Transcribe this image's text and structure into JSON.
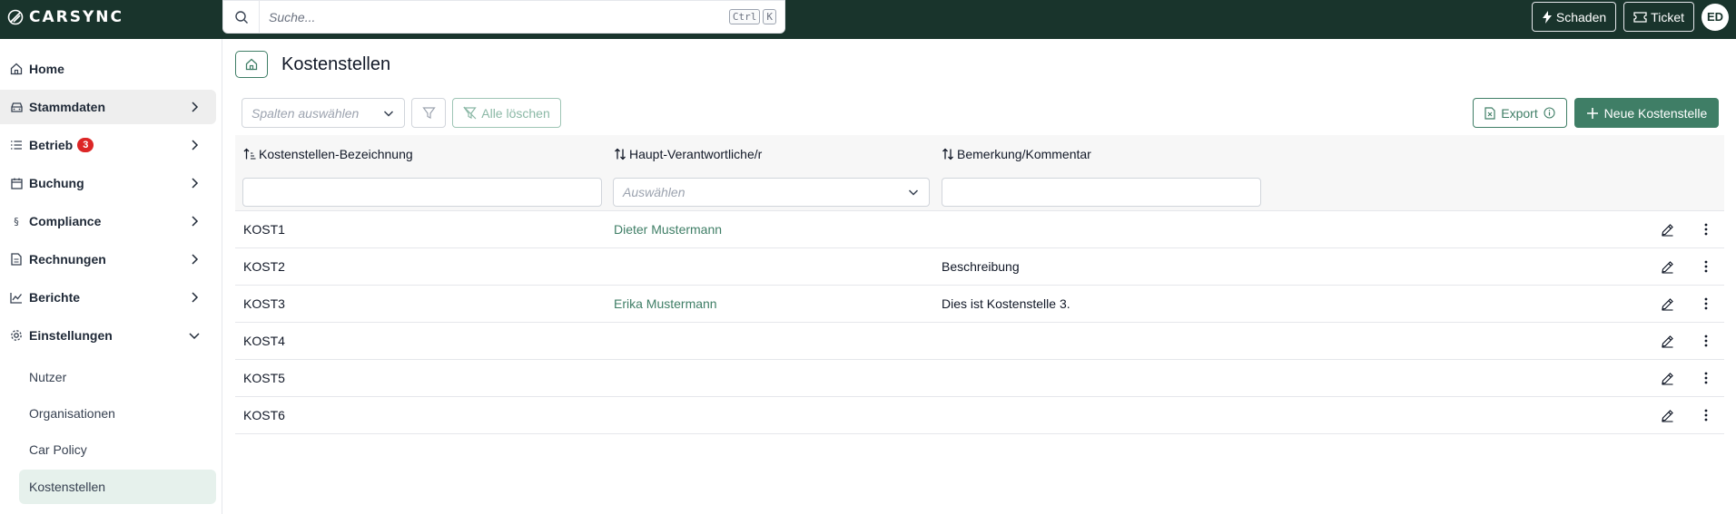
{
  "app": {
    "logo_text": "CARSYNC",
    "user_initials": "ED"
  },
  "search": {
    "placeholder": "Suche...",
    "kbd_ctrl": "Ctrl",
    "kbd_key": "K"
  },
  "topbar": {
    "schaden_label": "Schaden",
    "ticket_label": "Ticket"
  },
  "sidebar": {
    "items": [
      {
        "label": "Home",
        "icon": "home-icon"
      },
      {
        "label": "Stammdaten",
        "icon": "car-icon"
      },
      {
        "label": "Betrieb",
        "icon": "list-icon",
        "badge": "3"
      },
      {
        "label": "Buchung",
        "icon": "calendar-icon"
      },
      {
        "label": "Compliance",
        "icon": "paragraph-icon"
      },
      {
        "label": "Rechnungen",
        "icon": "invoice-icon"
      },
      {
        "label": "Berichte",
        "icon": "chart-icon"
      },
      {
        "label": "Einstellungen",
        "icon": "gear-icon"
      }
    ],
    "subitems": [
      "Nutzer",
      "Organisationen",
      "Car Policy",
      "Kostenstellen"
    ]
  },
  "page": {
    "title": "Kostenstellen"
  },
  "toolbar": {
    "columns_placeholder": "Spalten auswählen",
    "clear_label": "Alle löschen",
    "export_label": "Export",
    "new_label": "Neue Kostenstelle"
  },
  "table": {
    "columns": [
      "Kostenstellen-Bezeichnung",
      "Haupt-Verantwortliche/r",
      "Bemerkung/Kommentar"
    ],
    "responsible_filter_placeholder": "Auswählen",
    "rows": [
      {
        "name": "KOST1",
        "responsible": "Dieter Mustermann",
        "comment": ""
      },
      {
        "name": "KOST2",
        "responsible": "",
        "comment": "Beschreibung"
      },
      {
        "name": "KOST3",
        "responsible": "Erika Mustermann",
        "comment": "Dies ist Kostenstelle 3."
      },
      {
        "name": "KOST4",
        "responsible": "",
        "comment": ""
      },
      {
        "name": "KOST5",
        "responsible": "",
        "comment": ""
      },
      {
        "name": "KOST6",
        "responsible": "",
        "comment": ""
      }
    ]
  },
  "colors": {
    "topbar_bg": "#19342c",
    "primary": "#3f7e66",
    "badge": "#dc2626",
    "active_sub_bg": "#e6f1ec"
  }
}
